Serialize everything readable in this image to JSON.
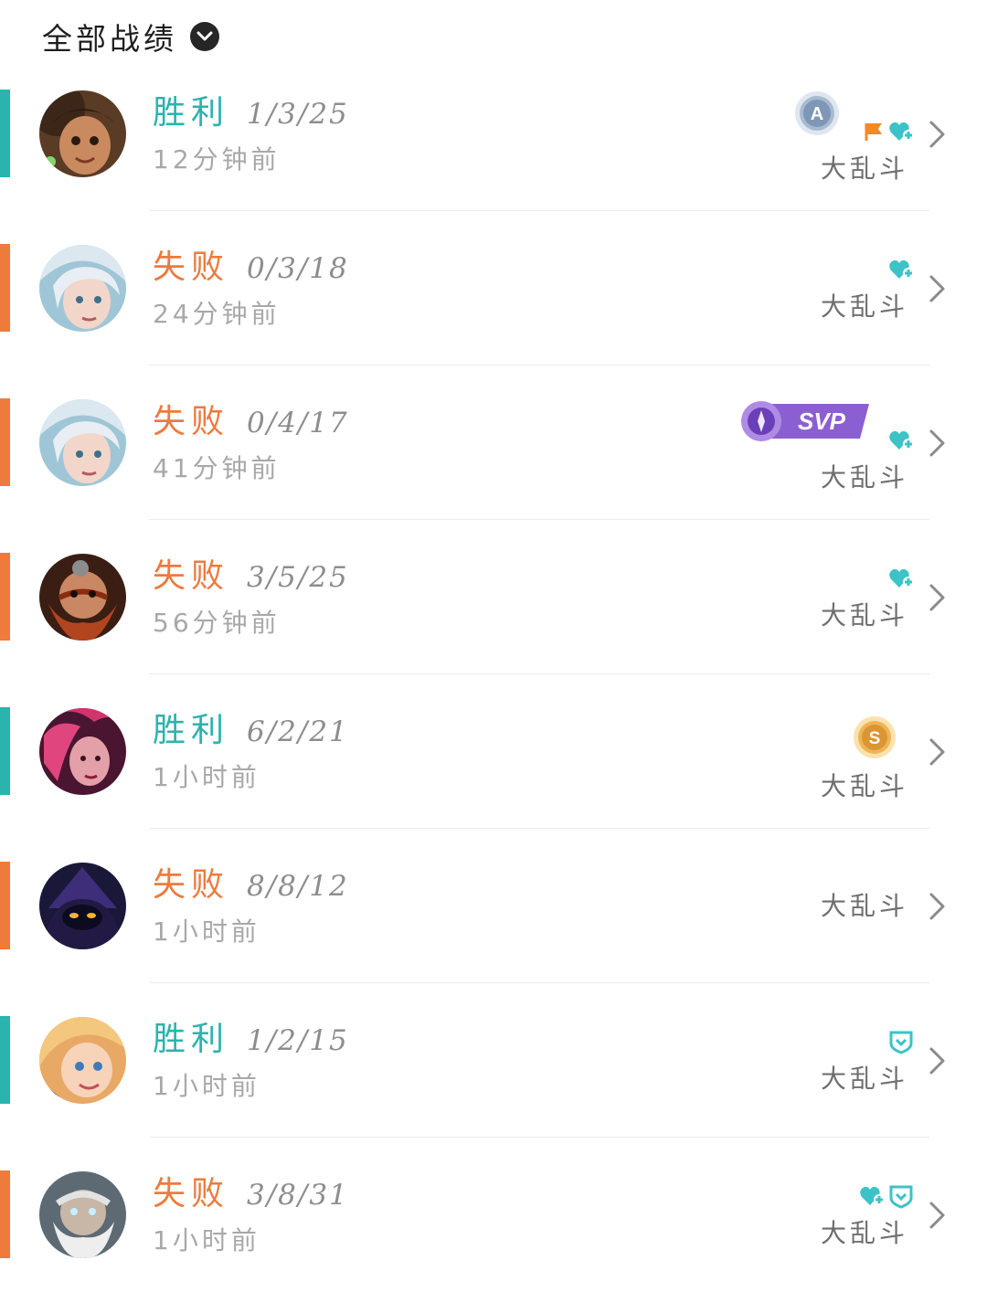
{
  "header": {
    "title": "全部战绩",
    "dropdown_icon": "chevron-down-icon"
  },
  "colors": {
    "win": "#2bb3ad",
    "loss": "#ee7a3c",
    "heart": "#3cc3c7",
    "flag": "#f38a23",
    "svp": "#8b5fd1"
  },
  "matches": [
    {
      "result": "胜利",
      "kda": "1/3/25",
      "time_ago": "12分钟前",
      "mode": "大乱斗",
      "badges": [
        "a-medal-icon",
        "flag-icon",
        "heart-plus-icon"
      ]
    },
    {
      "result": "失败",
      "kda": "0/3/18",
      "time_ago": "24分钟前",
      "mode": "大乱斗",
      "badges": [
        "heart-plus-icon"
      ]
    },
    {
      "result": "失败",
      "kda": "0/4/17",
      "time_ago": "41分钟前",
      "mode": "大乱斗",
      "badges": [
        "svp-badge",
        "heart-plus-icon"
      ],
      "svp_label": "SVP"
    },
    {
      "result": "失败",
      "kda": "3/5/25",
      "time_ago": "56分钟前",
      "mode": "大乱斗",
      "badges": [
        "heart-plus-icon"
      ]
    },
    {
      "result": "胜利",
      "kda": "6/2/21",
      "time_ago": "1小时前",
      "mode": "大乱斗",
      "badges": [
        "s-medal-icon"
      ]
    },
    {
      "result": "失败",
      "kda": "8/8/12",
      "time_ago": "1小时前",
      "mode": "大乱斗",
      "badges": []
    },
    {
      "result": "胜利",
      "kda": "1/2/15",
      "time_ago": "1小时前",
      "mode": "大乱斗",
      "badges": [
        "shield-icon"
      ]
    },
    {
      "result": "失败",
      "kda": "3/8/31",
      "time_ago": "1小时前",
      "mode": "大乱斗",
      "badges": [
        "heart-plus-icon",
        "shield-icon"
      ]
    }
  ]
}
